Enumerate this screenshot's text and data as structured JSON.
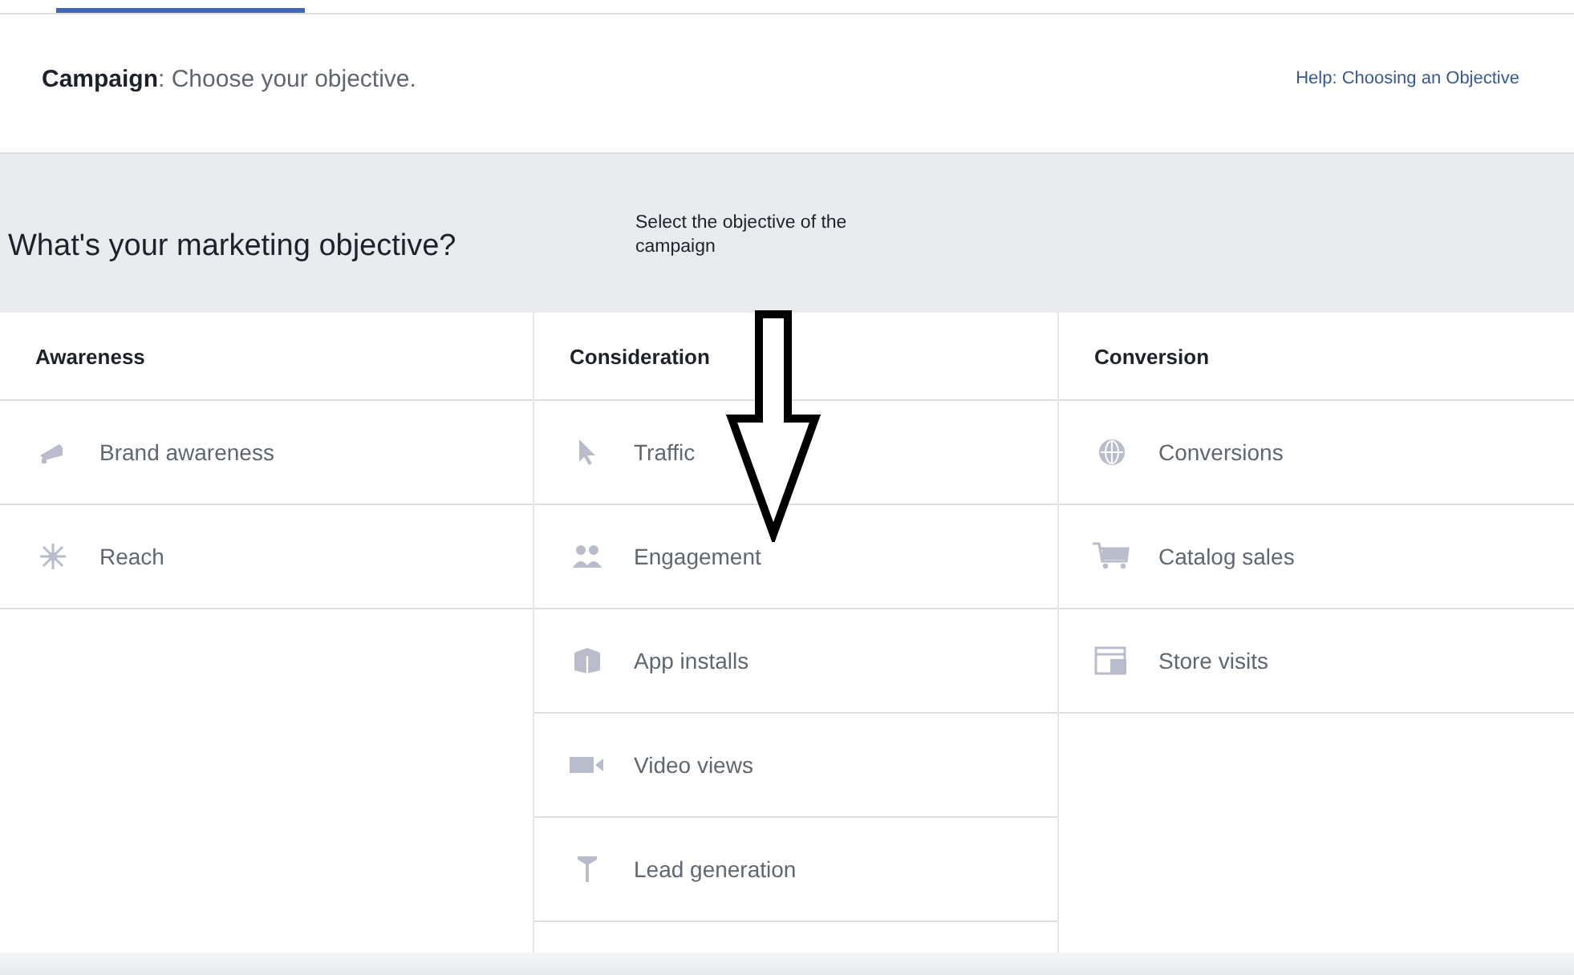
{
  "header": {
    "title": "**Campaign**: Choose your objective.",
    "help_link": "Help: Choosing an Objective"
  },
  "banner": {
    "question": "What's your marketing objective?",
    "annotation": "Select the objective of the campaign"
  },
  "columns": [
    {
      "title": "Awareness",
      "objectives": [
        "Brand awareness",
        "Reach"
      ]
    },
    {
      "title": "Consideration",
      "objectives": [
        "Traffic",
        "Engagement",
        "App installs",
        "Video views",
        "Lead generation"
      ]
    },
    {
      "title": "Conversion",
      "objectives": [
        "Conversions",
        "Catalog sales",
        "Store visits"
      ]
    }
  ]
}
